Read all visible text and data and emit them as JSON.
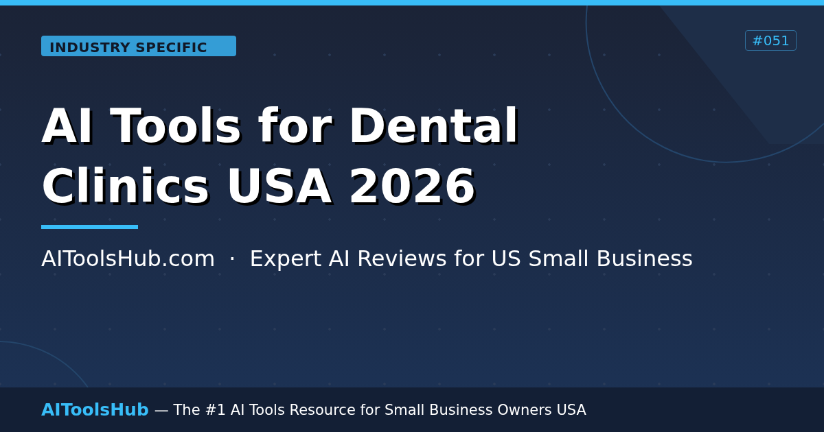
{
  "category_badge": "INDUSTRY SPECIFIC",
  "issue_number": "#051",
  "title_lines": [
    "AI Tools for Dental",
    "Clinics USA 2026"
  ],
  "subtitle": {
    "site": "AIToolsHub.com",
    "separator": "·",
    "tagline": "Expert AI Reviews for US Small Business"
  },
  "footer": {
    "brand": "AIToolsHub",
    "tagline": "— The #1 AI Tools Resource for Small Business Owners USA"
  }
}
